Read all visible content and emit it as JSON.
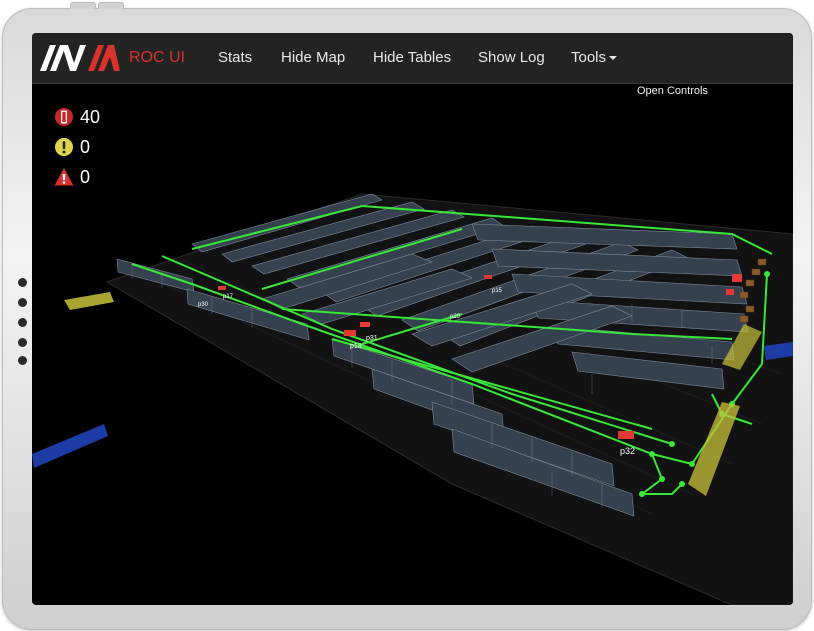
{
  "app": {
    "brand": "ROC UI",
    "brand_color": "#d8322c"
  },
  "navbar": {
    "items": [
      {
        "label": "Stats"
      },
      {
        "label": "Hide Map"
      },
      {
        "label": "Hide Tables"
      },
      {
        "label": "Show Log"
      },
      {
        "label": "Tools"
      }
    ],
    "tools_icon": "caret-down-icon"
  },
  "controls": {
    "open_label": "Open Controls"
  },
  "stats": [
    {
      "icon": "robot-battery-icon",
      "color": "#c62828",
      "value": "40"
    },
    {
      "icon": "warning-circle-icon",
      "color": "#e0d64b",
      "value": "0"
    },
    {
      "icon": "alert-triangle-icon",
      "color": "#d32f2f",
      "value": "0"
    }
  ],
  "map": {
    "robot_labels": [
      "p32",
      "p31",
      "p18",
      "p29",
      "p15",
      "p30",
      "p17"
    ],
    "path_color": "#39e639",
    "zone_color": "#c8c23a",
    "robot_color": "#e53935"
  }
}
